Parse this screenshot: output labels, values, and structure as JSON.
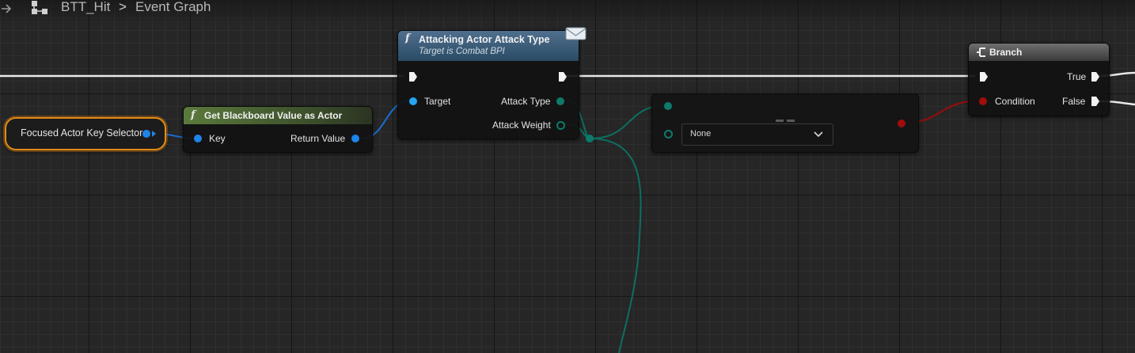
{
  "breadcrumb": {
    "asset": "BTT_Hit",
    "separator": ">",
    "graph": "Event Graph"
  },
  "nodes": {
    "key_selector": {
      "label": "Focused Actor Key Selector"
    },
    "get_blackboard": {
      "title": "Get Blackboard Value as Actor",
      "input_key": "Key",
      "output": "Return Value"
    },
    "attack_type": {
      "title": "Attacking Actor Attack Type",
      "subtitle": "Target is Combat BPI",
      "input_target": "Target",
      "output_attack_type": "Attack Type",
      "output_attack_weight": "Attack Weight"
    },
    "equal": {
      "dropdown_value": "None"
    },
    "branch": {
      "title": "Branch",
      "input_condition": "Condition",
      "output_true": "True",
      "output_false": "False"
    }
  },
  "colors": {
    "object_pin": "#1e84e8",
    "enum_pin": "#0d7a6b",
    "bool_pin": "#a10d0d",
    "exec_wire": "#e8e8e8",
    "selection_outline": "#e28a16"
  }
}
